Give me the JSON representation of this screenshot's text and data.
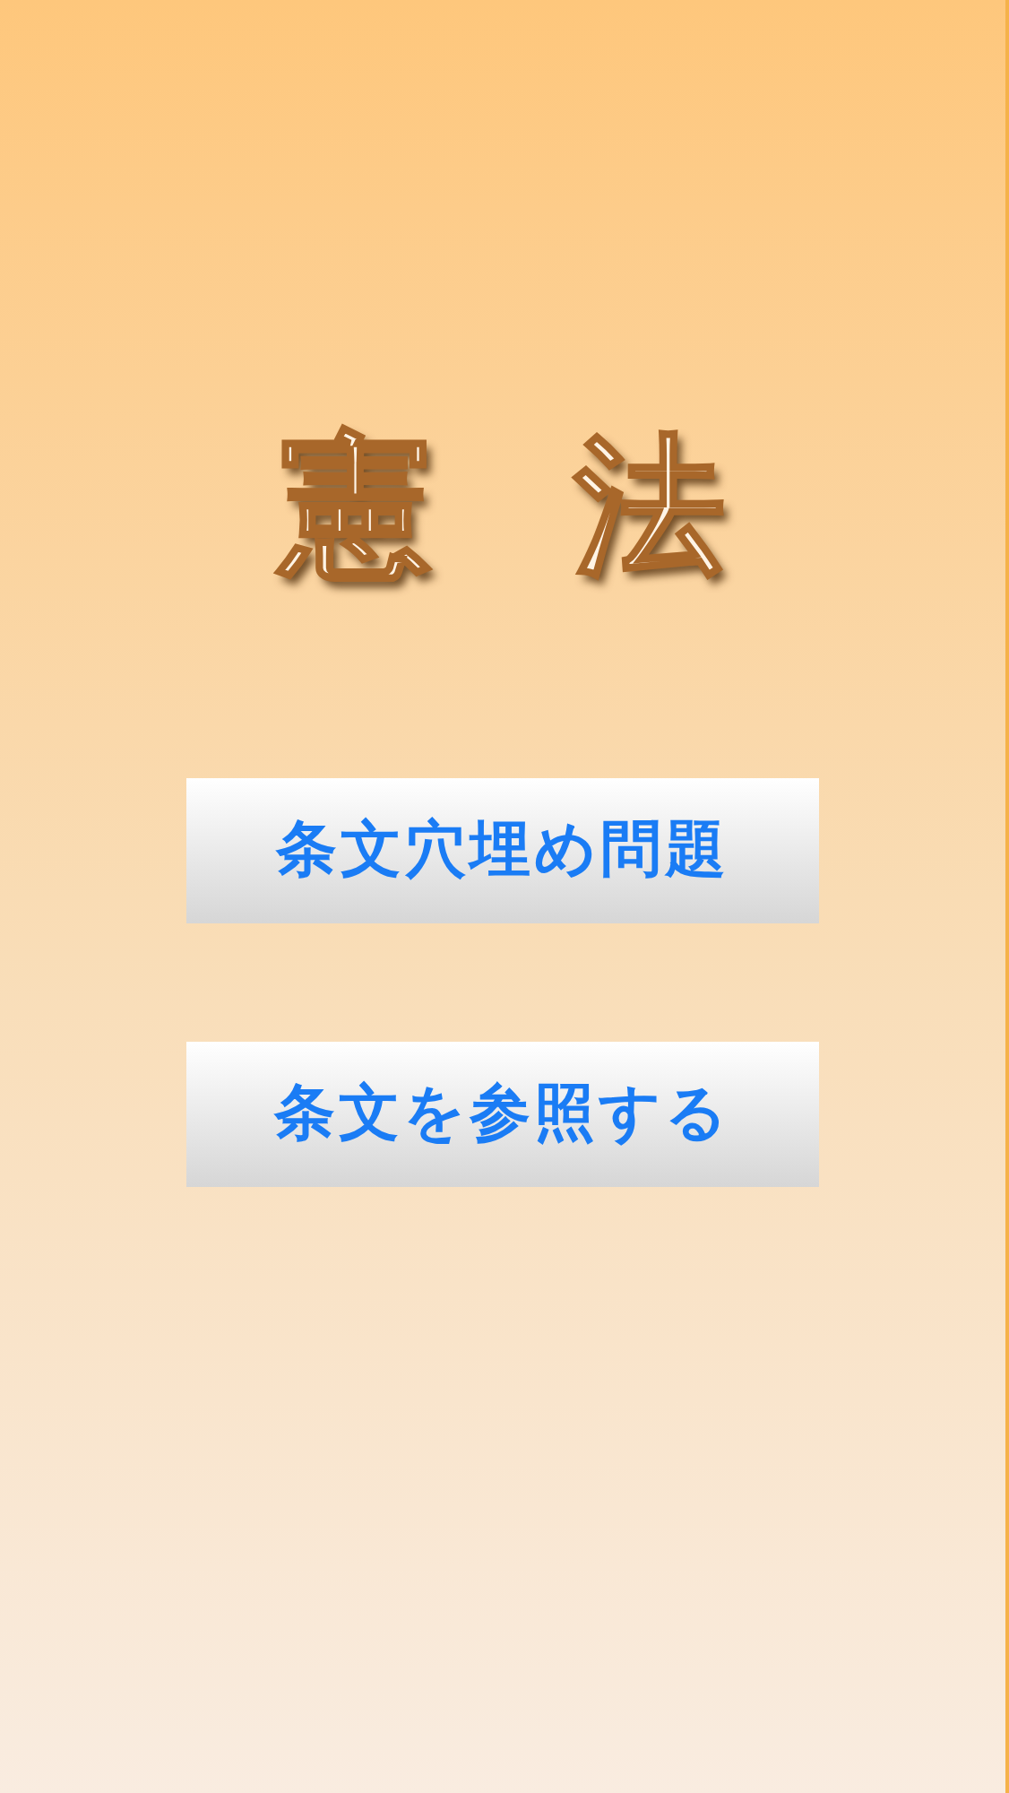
{
  "title": "憲法",
  "buttons": [
    {
      "label": "条文穴埋め問題"
    },
    {
      "label": "条文を参照する"
    }
  ]
}
